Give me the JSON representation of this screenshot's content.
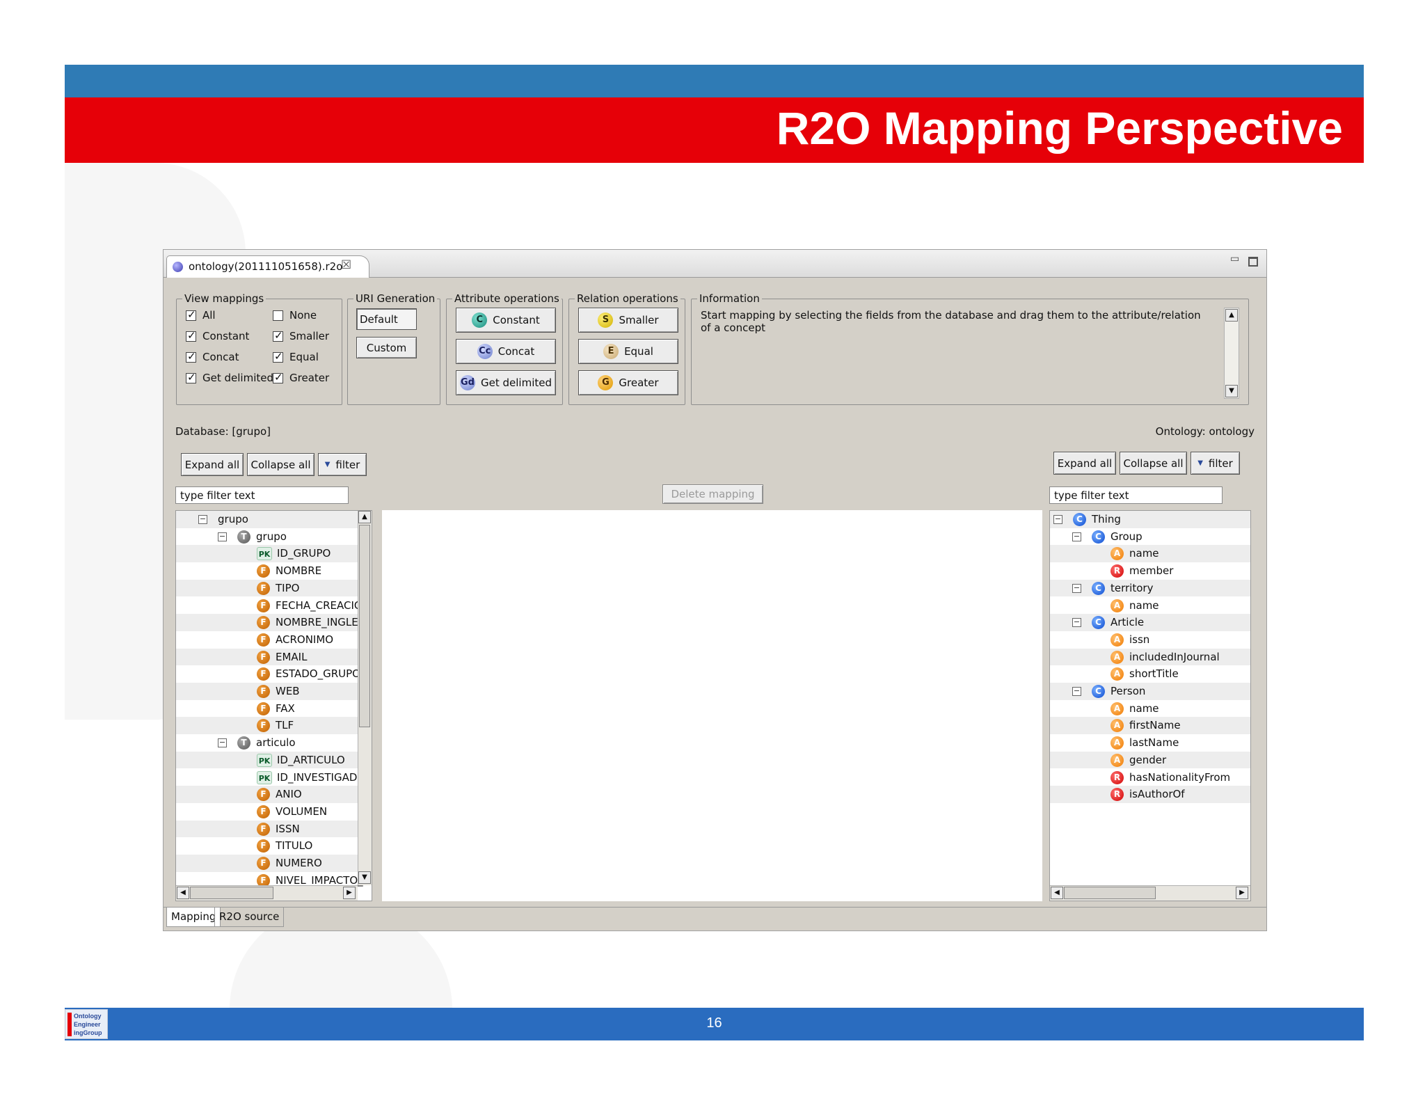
{
  "slide": {
    "title": "R2O Mapping Perspective",
    "page_number": "16",
    "logo_text": "Ontology\nEngineer\ningGroup"
  },
  "window": {
    "tab_title": "ontology(201111051658).r2o"
  },
  "view_mappings": {
    "legend": "View mappings",
    "options": [
      {
        "label": "All",
        "checked": true
      },
      {
        "label": "None",
        "checked": false
      },
      {
        "label": "Constant",
        "checked": true
      },
      {
        "label": "Smaller",
        "checked": true
      },
      {
        "label": "Concat",
        "checked": true
      },
      {
        "label": "Equal",
        "checked": true
      },
      {
        "label": "Get delimited",
        "checked": true
      },
      {
        "label": "Greater",
        "checked": true
      }
    ]
  },
  "uri_generation": {
    "legend": "URI Generation",
    "default_label": "Default",
    "custom_label": "Custom"
  },
  "attribute_operations": {
    "legend": "Attribute operations",
    "constant": {
      "badge": "C",
      "label": "Constant"
    },
    "concat": {
      "badge": "Cc",
      "label": "Concat"
    },
    "get_delimited": {
      "badge": "Gd",
      "label": "Get delimited"
    }
  },
  "relation_operations": {
    "legend": "Relation operations",
    "smaller": {
      "badge": "S",
      "label": "Smaller"
    },
    "equal": {
      "badge": "E",
      "label": "Equal"
    },
    "greater": {
      "badge": "G",
      "label": "Greater"
    }
  },
  "information": {
    "legend": "Information",
    "text": "Start mapping by selecting the fields from the database and drag them to the attribute/relation of a concept"
  },
  "database": {
    "label": "Database: [grupo]",
    "expand_all": "Expand all",
    "collapse_all": "Collapse all",
    "filter": "filter",
    "filter_placeholder": "type filter text",
    "tree": [
      {
        "level": 0,
        "icon": "",
        "label": "grupo",
        "toggle": "−"
      },
      {
        "level": 1,
        "icon": "T",
        "label": "grupo",
        "toggle": "−"
      },
      {
        "level": 2,
        "icon": "PK",
        "label": "ID_GRUPO"
      },
      {
        "level": 2,
        "icon": "F",
        "label": "NOMBRE"
      },
      {
        "level": 2,
        "icon": "F",
        "label": "TIPO"
      },
      {
        "level": 2,
        "icon": "F",
        "label": "FECHA_CREACION"
      },
      {
        "level": 2,
        "icon": "F",
        "label": "NOMBRE_INGLES"
      },
      {
        "level": 2,
        "icon": "F",
        "label": "ACRONIMO"
      },
      {
        "level": 2,
        "icon": "F",
        "label": "EMAIL"
      },
      {
        "level": 2,
        "icon": "F",
        "label": "ESTADO_GRUPO"
      },
      {
        "level": 2,
        "icon": "F",
        "label": "WEB"
      },
      {
        "level": 2,
        "icon": "F",
        "label": "FAX"
      },
      {
        "level": 2,
        "icon": "F",
        "label": "TLF"
      },
      {
        "level": 1,
        "icon": "T",
        "label": "articulo",
        "toggle": "−"
      },
      {
        "level": 2,
        "icon": "PK",
        "label": "ID_ARTICULO"
      },
      {
        "level": 2,
        "icon": "PK",
        "label": "ID_INVESTIGADOR"
      },
      {
        "level": 2,
        "icon": "F",
        "label": "ANIO"
      },
      {
        "level": 2,
        "icon": "F",
        "label": "VOLUMEN"
      },
      {
        "level": 2,
        "icon": "F",
        "label": "ISSN"
      },
      {
        "level": 2,
        "icon": "F",
        "label": "TITULO"
      },
      {
        "level": 2,
        "icon": "F",
        "label": "NUMERO"
      },
      {
        "level": 2,
        "icon": "F",
        "label": "NIVEL_IMPACTO_REV"
      }
    ]
  },
  "center": {
    "delete_mapping": "Delete mapping"
  },
  "ontology": {
    "label": "Ontology: ontology",
    "expand_all": "Expand all",
    "collapse_all": "Collapse all",
    "filter": "filter",
    "filter_placeholder": "type filter text",
    "tree": [
      {
        "level": 0,
        "icon": "C",
        "label": "Thing",
        "toggle": "−"
      },
      {
        "level": 1,
        "icon": "C",
        "label": "Group",
        "toggle": "−"
      },
      {
        "level": 2,
        "icon": "A",
        "label": "name"
      },
      {
        "level": 2,
        "icon": "R",
        "label": "member"
      },
      {
        "level": 1,
        "icon": "C",
        "label": "territory",
        "toggle": "−"
      },
      {
        "level": 2,
        "icon": "A",
        "label": "name"
      },
      {
        "level": 1,
        "icon": "C",
        "label": "Article",
        "toggle": "−"
      },
      {
        "level": 2,
        "icon": "A",
        "label": "issn"
      },
      {
        "level": 2,
        "icon": "A",
        "label": "includedInJournal"
      },
      {
        "level": 2,
        "icon": "A",
        "label": "shortTitle"
      },
      {
        "level": 1,
        "icon": "C",
        "label": "Person",
        "toggle": "−"
      },
      {
        "level": 2,
        "icon": "A",
        "label": "name"
      },
      {
        "level": 2,
        "icon": "A",
        "label": "firstName"
      },
      {
        "level": 2,
        "icon": "A",
        "label": "lastName"
      },
      {
        "level": 2,
        "icon": "A",
        "label": "gender"
      },
      {
        "level": 2,
        "icon": "R",
        "label": "hasNationalityFrom"
      },
      {
        "level": 2,
        "icon": "R",
        "label": "isAuthorOf"
      }
    ]
  },
  "bottom_tabs": [
    {
      "label": "Mapping",
      "active": true
    },
    {
      "label": "R2O source",
      "active": false
    }
  ],
  "colors": {
    "header_blue": "#2f7bb5",
    "header_red": "#e60008",
    "footer_blue": "#2a6cbf"
  },
  "icons": {
    "tab": "ontology-file-icon",
    "close": "close-icon",
    "minimize": "minimize-icon",
    "maximize": "maximize-icon",
    "filter": "triangle-down-icon"
  }
}
